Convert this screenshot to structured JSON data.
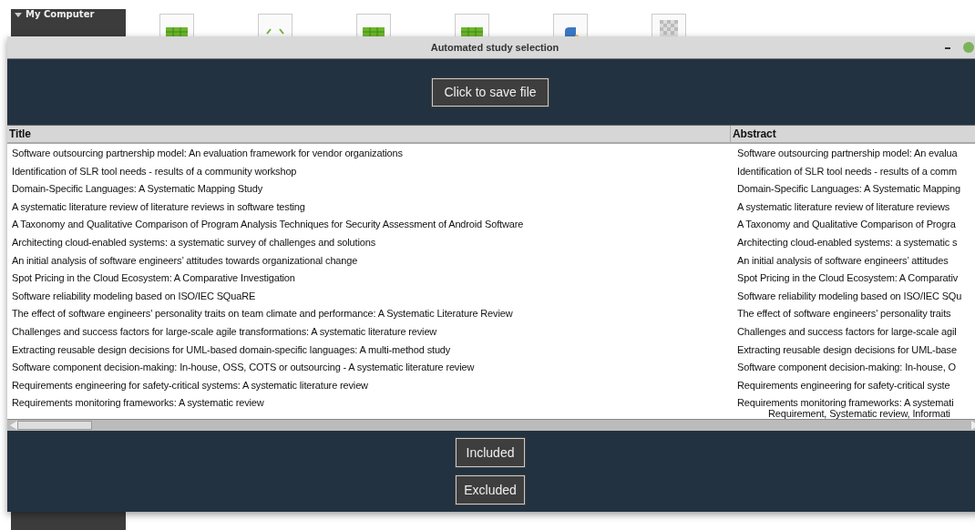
{
  "desktop": {
    "sidebar_heading": "My Computer",
    "icons": [
      {
        "kind": "spreadsheet"
      },
      {
        "kind": "code"
      },
      {
        "kind": "spreadsheet"
      },
      {
        "kind": "spreadsheet"
      },
      {
        "kind": "python"
      },
      {
        "kind": "image"
      }
    ]
  },
  "window": {
    "title": "Automated study selection"
  },
  "save_button": "Click to save file",
  "table": {
    "columns": [
      "Title",
      "Abstract"
    ],
    "rows": [
      {
        "title": "Software outsourcing partnership model: An evaluation framework for vendor organizations",
        "abstract": "Software outsourcing partnership model: An evalua"
      },
      {
        "title": "Identification of SLR tool needs - results of a community workshop",
        "abstract": "Identification of SLR tool needs - results of a comm"
      },
      {
        "title": "Domain-Specific Languages: A Systematic Mapping Study",
        "abstract": "Domain-Specific Languages: A Systematic Mapping"
      },
      {
        "title": "A systematic literature review of literature reviews in software testing",
        "abstract": "A systematic literature review of literature reviews"
      },
      {
        "title": "A Taxonomy and Qualitative Comparison of Program Analysis Techniques for Security Assessment of Android Software",
        "abstract": "A Taxonomy and Qualitative Comparison of Progra"
      },
      {
        "title": "Architecting cloud-enabled systems: a systematic survey of challenges and solutions",
        "abstract": "Architecting cloud-enabled systems: a systematic s"
      },
      {
        "title": "An initial analysis of software engineers’ attitudes towards organizational change",
        "abstract": "An initial analysis of software engineers’ attitudes"
      },
      {
        "title": "Spot Pricing in the Cloud Ecosystem: A Comparative Investigation",
        "abstract": "Spot Pricing in the Cloud Ecosystem: A Comparativ"
      },
      {
        "title": "Software reliability modeling based on ISO/IEC SQuaRE",
        "abstract": "Software reliability modeling based on ISO/IEC SQu"
      },
      {
        "title": "The effect of software engineers' personality traits on team climate and performance: A Systematic Literature Review",
        "abstract": "The effect of software engineers' personality traits"
      },
      {
        "title": "Challenges and success factors for large-scale agile transformations: A systematic literature review",
        "abstract": "Challenges and success factors for large-scale agil"
      },
      {
        "title": "Extracting reusable design decisions for UML-based domain-specific languages: A multi-method study",
        "abstract": "Extracting reusable design decisions for UML-base"
      },
      {
        "title": "Software component decision-making: In-house, OSS, COTS or outsourcing - A systematic literature review",
        "abstract": "Software component decision-making: In-house, O"
      },
      {
        "title": "Requirements engineering for safety-critical systems: A systematic literature review",
        "abstract": "Requirements engineering for safety-critical syste"
      },
      {
        "title": "Requirements monitoring frameworks: A systematic review",
        "abstract": "Requirements monitoring frameworks: A systemati",
        "abstract_continuation": "Requirement, Systematic review, Informati"
      }
    ]
  },
  "buttons": [
    "Included",
    "Excluded"
  ]
}
